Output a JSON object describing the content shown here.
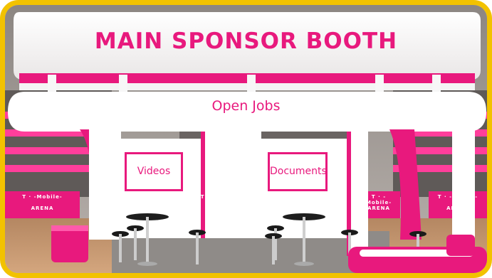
{
  "booth": {
    "title": "MAIN SPONSOR BOOTH",
    "banner": "Open Jobs",
    "screens": [
      {
        "label": "Videos"
      },
      {
        "label": "Documents"
      }
    ],
    "arena_signs": [
      {
        "line1": "T · -Mobile-",
        "line2": "ARENA"
      },
      {
        "line1": "T · -Mobile-",
        "line2": "ARENA"
      },
      {
        "line1": "T · -Mobile-",
        "line2": "ARENA"
      },
      {
        "line1": "T · -Mobile-",
        "line2": "ARENA"
      }
    ]
  },
  "colors": {
    "frame": "#f2c200",
    "brand": "#e8197d",
    "booth_white": "#ffffff",
    "floor": "#c89a74"
  }
}
